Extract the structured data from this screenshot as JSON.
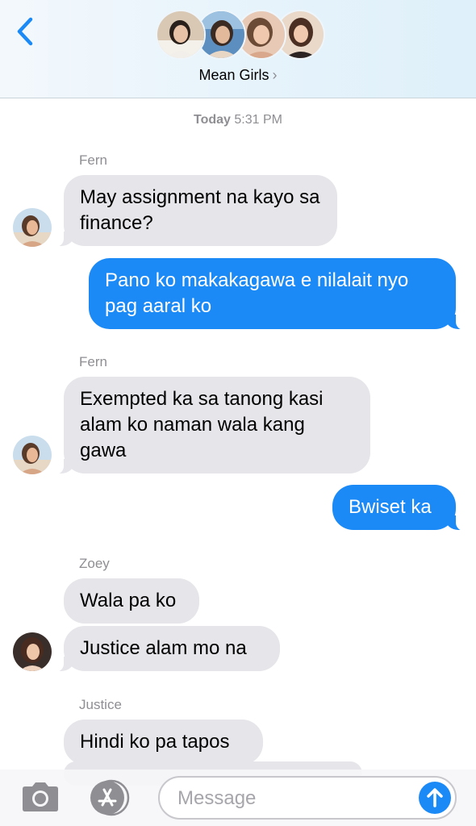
{
  "header": {
    "group_name": "Mean Girls",
    "chevron": "›",
    "back_icon": "chevron-left-icon",
    "member_avatar_count": 4
  },
  "timestamp": {
    "day": "Today",
    "time": "5:31 PM"
  },
  "messages": [
    {
      "sender": "Fern",
      "direction": "received",
      "text": "May assignment na kayo sa finance?"
    },
    {
      "sender": "",
      "direction": "sent",
      "text": "Pano ko makakagawa e nilalait nyo pag aaral ko"
    },
    {
      "sender": "Fern",
      "direction": "received",
      "text": "Exempted ka sa tanong kasi alam ko naman wala kang gawa"
    },
    {
      "sender": "",
      "direction": "sent",
      "text": "Bwiset ka"
    },
    {
      "sender": "Zoey",
      "direction": "received",
      "text": "Wala pa ko"
    },
    {
      "sender": "Zoey",
      "direction": "received",
      "text": "Justice alam mo na"
    },
    {
      "sender": "Justice",
      "direction": "received",
      "text": "Hindi ko pa tapos"
    }
  ],
  "input_bar": {
    "placeholder": "Message",
    "camera_icon": "camera-icon",
    "apps_icon": "app-store-icon",
    "send_icon": "arrow-up-icon"
  },
  "colors": {
    "sent_bubble": "#1b8af6",
    "received_bubble": "#e5e5ea",
    "accent": "#1b8af6",
    "secondary_text": "#8e8e93"
  }
}
